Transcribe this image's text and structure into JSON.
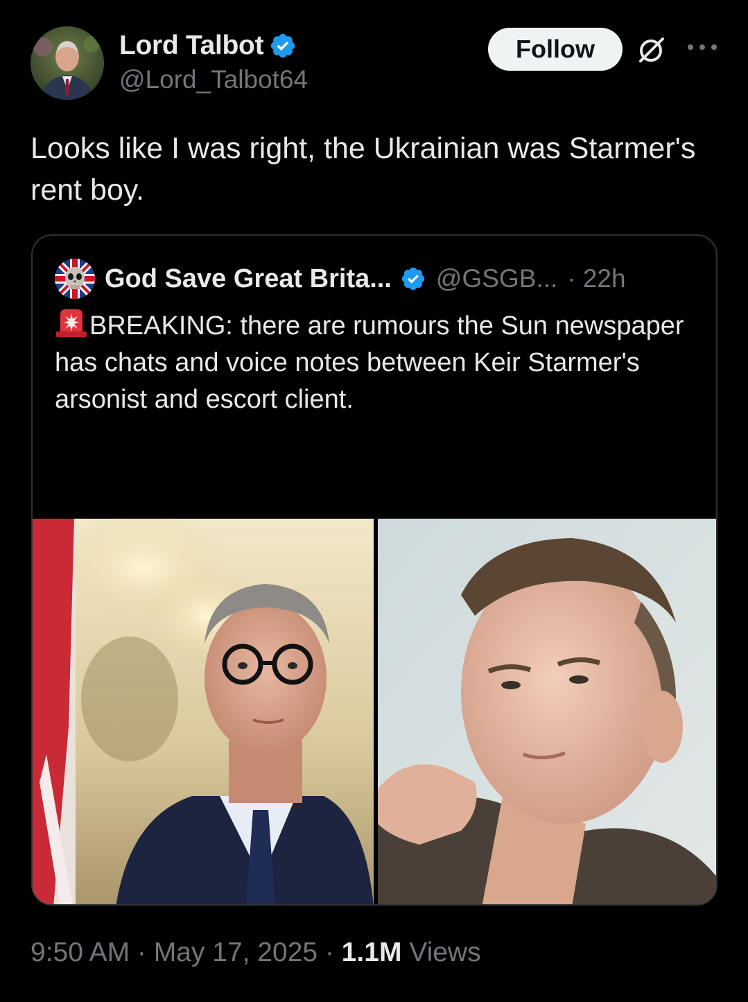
{
  "post": {
    "author": {
      "display_name": "Lord Talbot",
      "handle": "@Lord_Talbot64",
      "verified": true,
      "avatar_icon": "profile-photo"
    },
    "follow_label": "Follow",
    "text": "Looks like I was right, the Ukrainian was Starmer's rent boy.",
    "timestamp": "9:50 AM · May 17, 2025 · ",
    "views_count": "1.1M",
    "views_label": " Views"
  },
  "quoted": {
    "display_name": "God Save Great Brita...",
    "handle": "@GSGB...",
    "time": "· 22h",
    "verified": true,
    "text": "BREAKING: there are rumours the Sun newspaper has chats and voice notes between Keir Starmer's arsonist and escort client.",
    "ellipsis": "...",
    "emoji_icon": "police-siren-icon"
  },
  "colors": {
    "background": "#000000",
    "text_primary": "#e7e9ea",
    "text_secondary": "#71767b",
    "verified_blue": "#1d9bf0",
    "border": "#2f3336",
    "follow_bg": "#eff3f4"
  }
}
